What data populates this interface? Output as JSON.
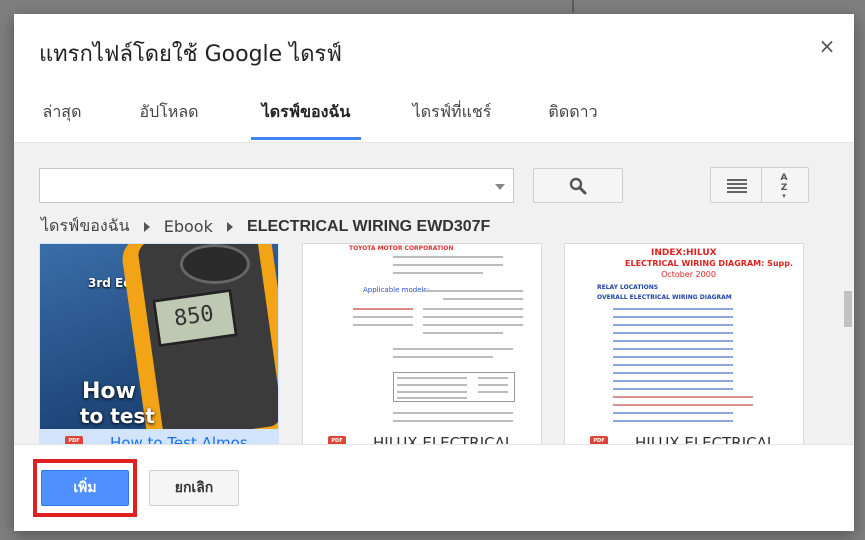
{
  "dialog": {
    "title": "แทรกไฟล์โดยใช้ Google ไดรฟ์",
    "close_glyph": "×"
  },
  "tabs": [
    {
      "label": "ล่าสุด",
      "active": false
    },
    {
      "label": "อัปโหลด",
      "active": false
    },
    {
      "label": "ไดรฟ์ของฉัน",
      "active": true
    },
    {
      "label": "ไดรฟ์ที่แชร์",
      "active": false
    },
    {
      "label": "ติดดาว",
      "active": false
    }
  ],
  "search": {
    "value": "",
    "placeholder": ""
  },
  "icons": {
    "search": "search-icon",
    "list_view": "list-view-icon",
    "sort": "sort-az-icon",
    "file_type": "pdf-icon"
  },
  "sort_label": {
    "top": "A",
    "bottom": "Z"
  },
  "breadcrumb": [
    "ไดรฟ์ของฉัน",
    "Ebook",
    "ELECTRICAL WIRING EWD307F"
  ],
  "files": [
    {
      "name": "How to Test Almos",
      "type_badge": "PDF",
      "selected": true,
      "thumb_text": {
        "edition": "3rd Edition",
        "reading": "850",
        "cover_title_1": "How",
        "cover_title_2": "to test"
      }
    },
    {
      "name": "HILUX ELECTRICAL",
      "type_badge": "PDF",
      "selected": false,
      "thumb_text": {
        "header": "TOYOTA MOTOR CORPORATION",
        "models": "Applicable models:"
      }
    },
    {
      "name": "HILUX ELECTRICAL",
      "type_badge": "PDF",
      "selected": false,
      "thumb_text": {
        "index": "INDEX:HILUX",
        "diagram": "ELECTRICAL WIRING DIAGRAM: Supp.",
        "date": "October 2000",
        "relay": "RELAY LOCATIONS",
        "overall": "OVERALL ELECTRICAL WIRING DIAGRAM"
      }
    }
  ],
  "buttons": {
    "insert": "เพิ่ม",
    "cancel": "ยกเลิก"
  },
  "colors": {
    "accent": "#4285f4",
    "primary_button": "#4d90fe",
    "highlight": "#e02020",
    "selected_card": "#d2e3fc",
    "pdf_red": "#db4437"
  }
}
